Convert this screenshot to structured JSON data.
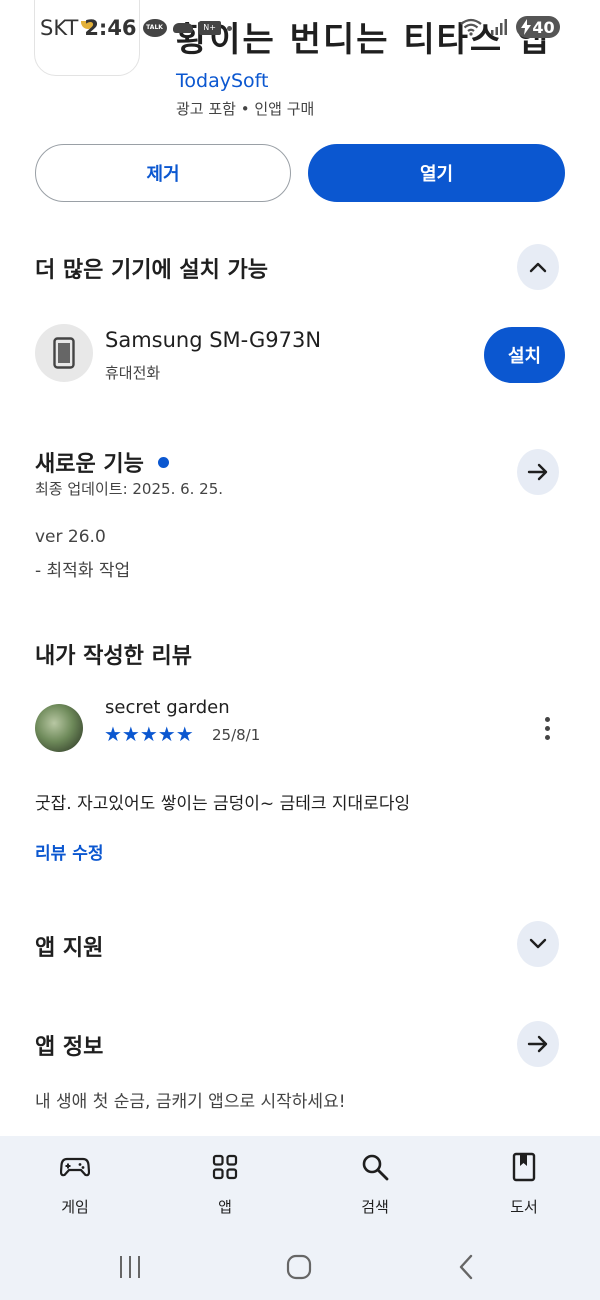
{
  "status_bar": {
    "carrier": "SKT",
    "time": "2:46",
    "battery": "40",
    "icons": [
      "kakaotalk-icon",
      "cloud-icon",
      "card-icon",
      "dot-icon",
      "wifi-icon",
      "signal-icon",
      "battery-charging-icon"
    ]
  },
  "app": {
    "title": "황이는 번디는 티타스 앱",
    "developer": "TodaySoft",
    "meta": "광고 포함 • 인앱 구매",
    "remove_label": "제거",
    "open_label": "열기"
  },
  "devices": {
    "title": "더 많은 기기에 설치 가능",
    "device_name": "Samsung SM-G973N",
    "device_type": "휴대전화",
    "install_label": "설치"
  },
  "whats_new": {
    "title": "새로운 기능",
    "updated": "최종 업데이트: 2025. 6. 25.",
    "notes": [
      "ver 26.0",
      "- 최적화 작업"
    ]
  },
  "my_review": {
    "title": "내가 작성한 리뷰",
    "reviewer": "secret garden",
    "rating": 5,
    "stars": "★★★★★",
    "date": "25/8/1",
    "text": "굿잡. 자고있어도 쌓이는 금덩이~ 금테크 지대로다잉",
    "edit_label": "리뷰 수정"
  },
  "app_support": {
    "title": "앱 지원"
  },
  "app_info": {
    "title": "앱 정보",
    "description": "내 생애 첫 순금, 금캐기 앱으로 시작하세요!"
  },
  "bottom_nav": {
    "items": [
      {
        "label": "게임",
        "icon": "gamepad-icon"
      },
      {
        "label": "앱",
        "icon": "apps-grid-icon"
      },
      {
        "label": "검색",
        "icon": "search-icon"
      },
      {
        "label": "도서",
        "icon": "book-icon"
      }
    ]
  },
  "system_nav": {
    "icons": [
      "recents-icon",
      "home-icon",
      "back-icon"
    ]
  },
  "colors": {
    "accent": "#0b57d0",
    "chip_bg": "#e7ecf5",
    "nav_bg": "#eef2f8"
  }
}
